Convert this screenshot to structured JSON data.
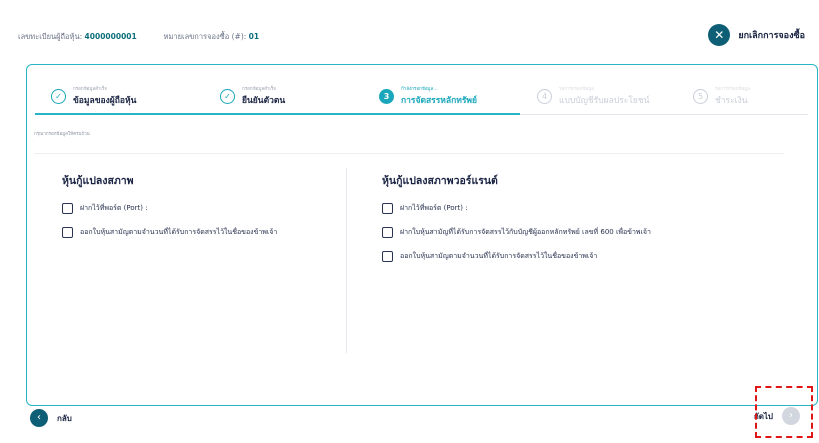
{
  "header": {
    "reg_label": "เลขทะเบียนผู้ถือหุ้น:",
    "reg_value": "4000000001",
    "order_label": "หมายเลขการจองซื้อ (#):",
    "order_value": "01",
    "cancel_label": "ยกเลิกการจองซื้อ",
    "cancel_icon": "✕"
  },
  "steps": [
    {
      "small": "กรอกข้อมูลสำเร็จ",
      "label": "ข้อมูลของผู้ถือหุ้น",
      "icon": "✓",
      "state": "done"
    },
    {
      "small": "กรอกข้อมูลสำเร็จ",
      "label": "ยืนยันตัวตน",
      "icon": "✓",
      "state": "done"
    },
    {
      "small": "กำลังกรอกข้อมูล...",
      "label": "การจัดสรรหลักทรัพย์",
      "icon": "3",
      "state": "active"
    },
    {
      "small": "รอการกรอกข้อมูล",
      "label": "แบบบัญชีรับผลประโยชน์",
      "icon": "4",
      "state": "pending"
    },
    {
      "small": "รอการกรอกข้อมูล",
      "label": "ชำระเงิน",
      "icon": "5",
      "state": "pending"
    }
  ],
  "hint": "กรุณากรอกข้อมูลให้ครบถ้วน",
  "left": {
    "title": "หุ้นกู้แปลงสภาพ",
    "options": [
      "ฝากไว้ที่พอร์ต (Port) :",
      "ออกใบหุ้นสามัญตามจำนวนที่ได้รับการจัดสรรไว้ในชื่อของข้าพเจ้า"
    ]
  },
  "right": {
    "title": "หุ้นกู้แปลงสภาพวอร์แรนต์",
    "options": [
      "ฝากไว้ที่พอร์ต (Port) :",
      "ฝากใบหุ้นสามัญที่ได้รับการจัดสรรไว้กับบัญชีผู้ออกหลักทรัพย์ เลขที่ 600 เพื่อข้าพเจ้า",
      "ออกใบหุ้นสามัญตามจำนวนที่ได้รับการจัดสรรไว้ในชื่อของข้าพเจ้า"
    ]
  },
  "footer": {
    "back_label": "กลับ",
    "back_icon": "‹",
    "next_label": "ถัดไป",
    "next_icon": "›"
  },
  "colors": {
    "accent": "#1aa7bb",
    "dark_teal": "#0e5f75",
    "highlight": "#e01515"
  }
}
